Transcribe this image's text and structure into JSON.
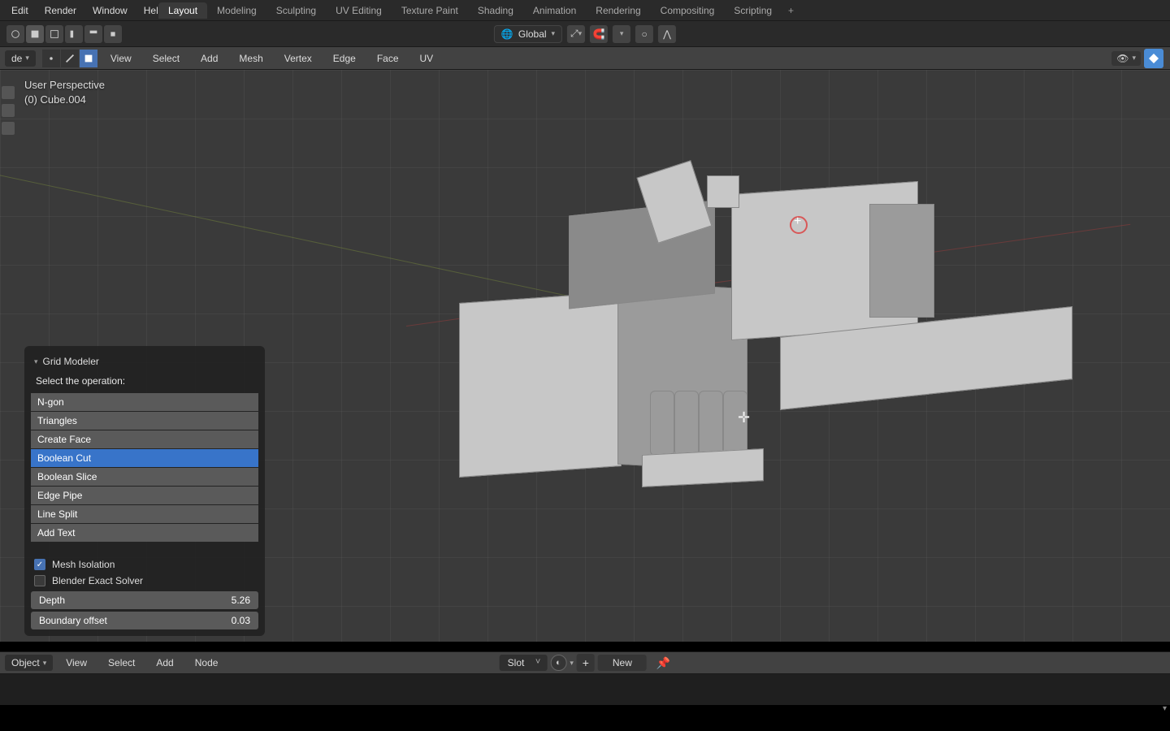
{
  "top_menu": {
    "items": [
      "Edit",
      "Render",
      "Window",
      "Help"
    ]
  },
  "workspaces": {
    "tabs": [
      "Layout",
      "Modeling",
      "Sculpting",
      "UV Editing",
      "Texture Paint",
      "Shading",
      "Animation",
      "Rendering",
      "Compositing",
      "Scripting"
    ],
    "active": "Layout",
    "add": "+"
  },
  "orientation": {
    "label": "Global"
  },
  "mode": {
    "label": "de"
  },
  "mode_menus": [
    "View",
    "Select",
    "Add",
    "Mesh",
    "Vertex",
    "Edge",
    "Face",
    "UV"
  ],
  "overlay": {
    "line1": "User Perspective",
    "line2": "(0) Cube.004"
  },
  "op_panel": {
    "title": "Grid Modeler",
    "subtitle": "Select the operation:",
    "items": [
      "N-gon",
      "Triangles",
      "Create Face",
      "Boolean Cut",
      "Boolean Slice",
      "Edge Pipe",
      "Line Split",
      "Add Text"
    ],
    "selected": "Boolean Cut",
    "check1": {
      "label": "Mesh Isolation",
      "checked": true
    },
    "check2": {
      "label": "Blender Exact Solver",
      "checked": false
    },
    "depth": {
      "label": "Depth",
      "value": "5.26"
    },
    "boundary": {
      "label": "Boundary offset",
      "value": "0.03"
    }
  },
  "node": {
    "mode": "Object",
    "menus": [
      "View",
      "Select",
      "Add",
      "Node"
    ],
    "slot": "Slot",
    "new": "New"
  }
}
